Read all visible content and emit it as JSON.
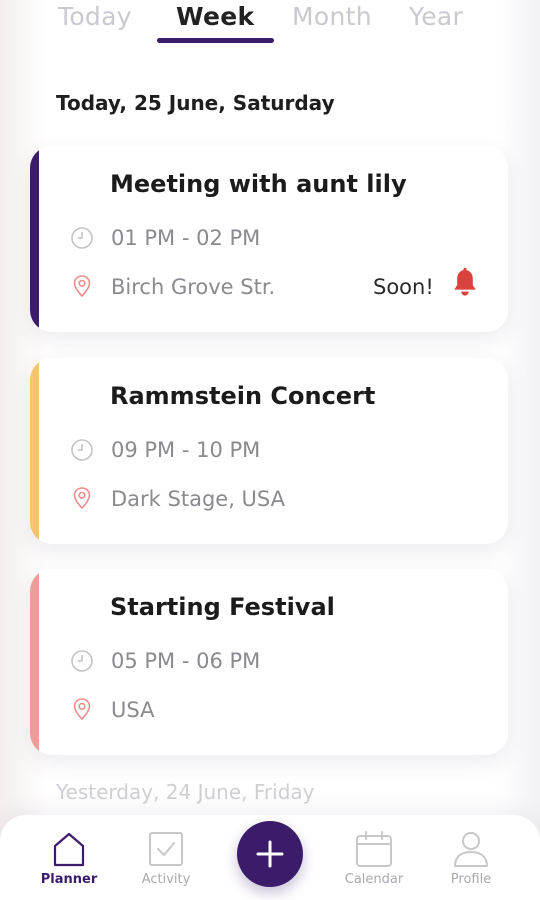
{
  "tabs": [
    {
      "label": "Today",
      "active": false
    },
    {
      "label": "Week",
      "active": true
    },
    {
      "label": "Month",
      "active": false
    },
    {
      "label": "Year",
      "active": false
    }
  ],
  "sections": {
    "today": "Today, 25 June, Saturday",
    "yesterday": "Yesterday, 24 June, Friday"
  },
  "events": [
    {
      "title": "Meeting with aunt lily",
      "time": "01 PM - 02 PM",
      "location": "Birch Grove Str.",
      "status": "Soon!",
      "accent_color": "#3b1c6b",
      "icons": [
        "clock-icon",
        "location-pin-icon",
        "bell-icon"
      ]
    },
    {
      "title": "Rammstein Concert",
      "time": "09 PM - 10 PM",
      "location": "Dark Stage, USA",
      "accent_color": "#f7c46a",
      "icons": [
        "clock-icon",
        "location-pin-icon"
      ]
    },
    {
      "title": "Starting Festival",
      "time": "05 PM - 06 PM",
      "location": "USA",
      "accent_color": "#f29a9a",
      "icons": [
        "clock-icon",
        "location-pin-icon"
      ]
    }
  ],
  "bottom_nav": {
    "items": [
      {
        "label": "Planner",
        "icon": "home-icon",
        "active": true
      },
      {
        "label": "Activity",
        "icon": "checkbox-icon",
        "active": false
      },
      {
        "label": "Calendar",
        "icon": "calendar-icon",
        "active": false
      },
      {
        "label": "Profile",
        "icon": "user-icon",
        "active": false
      }
    ],
    "add_button_icon": "plus-icon"
  },
  "colors": {
    "brand": "#3b1c6b",
    "alert": "#d9423d",
    "pin": "#f08c8c",
    "muted_text": "#8a8a8f"
  }
}
